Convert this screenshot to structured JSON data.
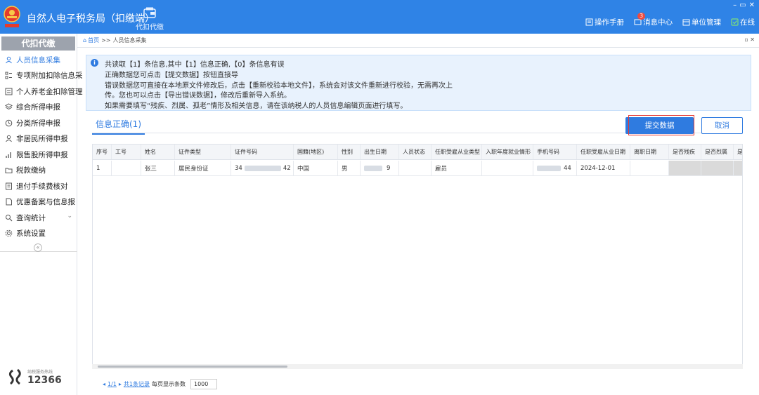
{
  "header": {
    "title": "自然人电子税务局（扣缴端）",
    "nav_label": "代扣代缴",
    "manual": "操作手册",
    "messages": "消息中心",
    "message_count": "3",
    "unit_manage": "单位管理",
    "online": "在线",
    "window_controls": [
      "–",
      "▭",
      "✕"
    ]
  },
  "sidebar": {
    "title": "代扣代缴",
    "items": [
      {
        "label": "人员信息采集",
        "icon": "person-icon",
        "active": true
      },
      {
        "label": "专项附加扣除信息采",
        "icon": "list-icon"
      },
      {
        "label": "个人养老金扣除管理",
        "icon": "card-icon"
      },
      {
        "label": "综合所得申报",
        "icon": "layers-icon"
      },
      {
        "label": "分类所得申报",
        "icon": "clock-icon"
      },
      {
        "label": "非居民所得申报",
        "icon": "user-outline-icon"
      },
      {
        "label": "限售股所得申报",
        "icon": "bar-chart-icon"
      },
      {
        "label": "税款缴纳",
        "icon": "folder-icon"
      },
      {
        "label": "退付手续费核对",
        "icon": "document-check-icon"
      },
      {
        "label": "优惠备案与信息报",
        "icon": "file-icon",
        "chevron": true
      },
      {
        "label": "查询统计",
        "icon": "search-data-icon",
        "chevron": true
      },
      {
        "label": "系统设置",
        "icon": "gear-icon"
      }
    ],
    "hotline_caption": "纳税服务热线",
    "hotline": "12366"
  },
  "breadcrumb": {
    "home": "首页",
    "separator": ">>",
    "current": "人员信息采集"
  },
  "info": {
    "lines": [
      "共读取【1】条信息,其中【1】信息正确,【0】条信息有误",
      "正确数据您可点击【提交数据】按钮直接导",
      "错误数据您可直接在本地原文件修改后，点击【重新校验本地文件】，系统会对该文件重新进行校验，无需再次上",
      "传。您也可以点击【导出错误数据】，修改后重新导入系统。",
      "如果需要填写“残疾、烈属、孤老”情形及相关信息，请在该纳税人的人员信息编辑页面进行填写。"
    ]
  },
  "tabs": {
    "correct": "信息正确(1)"
  },
  "buttons": {
    "submit": "提交数据",
    "cancel": "取消"
  },
  "table": {
    "headers": [
      "序号",
      "工号",
      "姓名",
      "证件类型",
      "证件号码",
      "国籍(地区)",
      "性别",
      "出生日期",
      "人员状态",
      "任职受雇从业类型",
      "入职年度就业情形",
      "手机号码",
      "任职受雇从业日期",
      "离职日期",
      "是否残疾",
      "是否烈属",
      "是否"
    ],
    "rows": [
      {
        "seq": "1",
        "emp_no": "",
        "name": "张三",
        "id_type": "居民身份证",
        "id_prefix": "34",
        "id_suffix": "42",
        "nationality": "中国",
        "gender": "男",
        "birth_suffix": "9",
        "status": "",
        "employment_type": "雇员",
        "entry_situation": "",
        "phone_suffix": "44",
        "hire_date": "2024-12-01",
        "leave_date": ""
      }
    ]
  },
  "pager": {
    "pages": "1/1",
    "records": "共1条记录",
    "per_page_label": "每页显示条数",
    "per_page": "1000"
  },
  "colors": {
    "primary": "#2f7be0",
    "header": "#2f83e6",
    "highlight": "#e53935"
  }
}
